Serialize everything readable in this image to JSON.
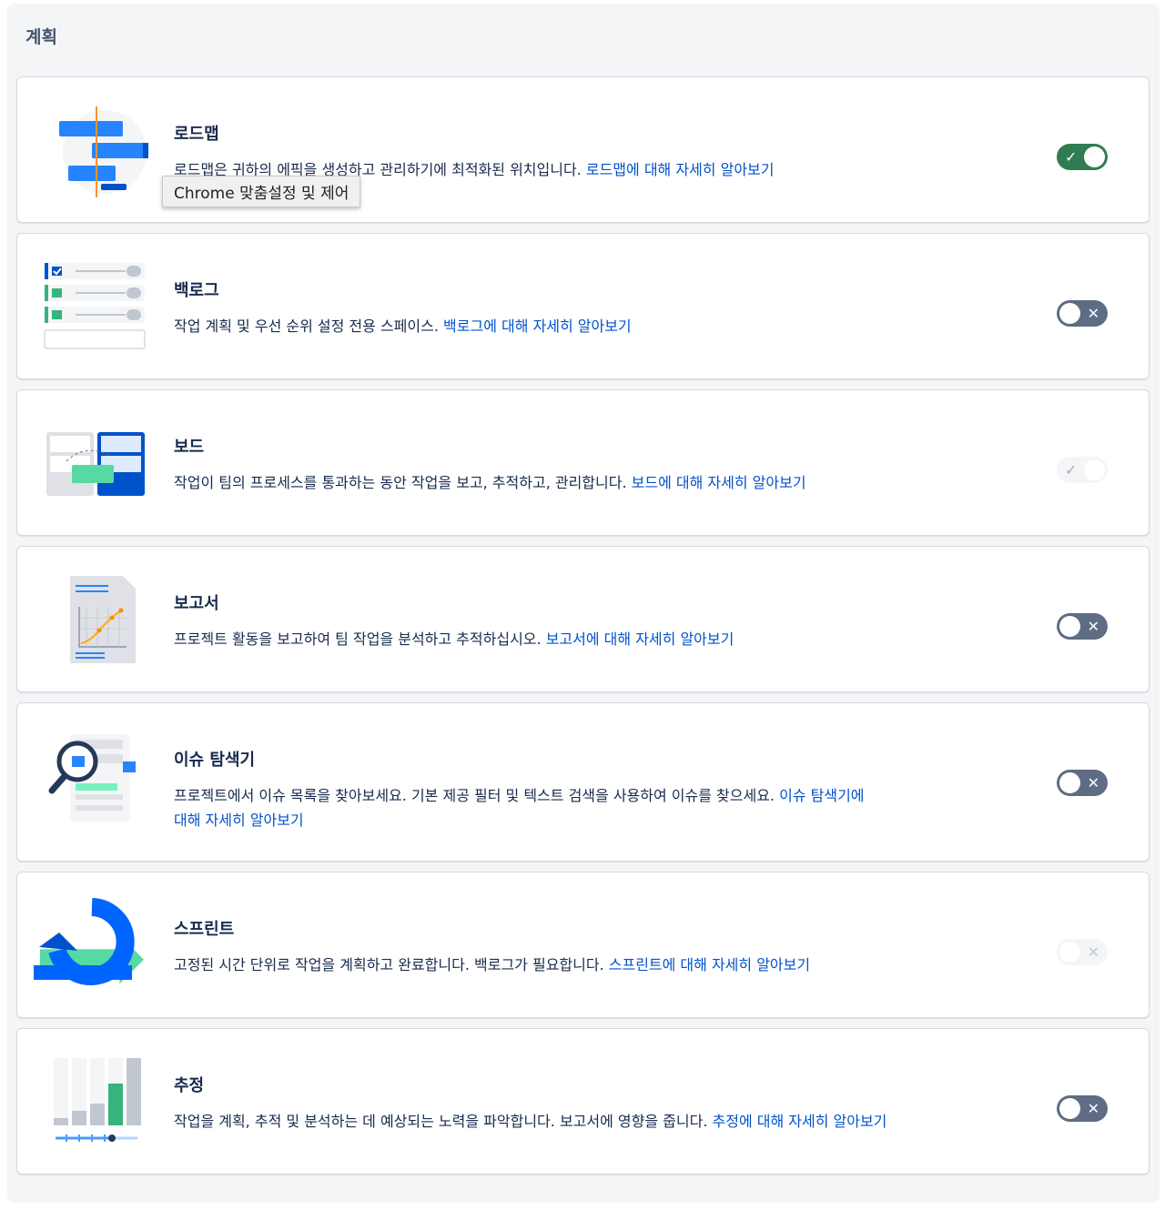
{
  "section": {
    "title": "계획"
  },
  "features": [
    {
      "title": "로드맵",
      "description": "로드맵은 귀하의 에픽을 생성하고 관리하기에 최적화된 위치입니다.",
      "link": "로드맵에 대해 자세히 알아보기",
      "toggle": {
        "state": "on",
        "enabled": true,
        "mark": "✓"
      },
      "icon": "roadmap-illustration"
    },
    {
      "title": "백로그",
      "description": "작업 계획 및 우선 순위 설정 전용 스페이스.",
      "link": "백로그에 대해 자세히 알아보기",
      "toggle": {
        "state": "off",
        "enabled": true,
        "mark": "✕"
      },
      "icon": "backlog-illustration"
    },
    {
      "title": "보드",
      "description": "작업이 팀의 프로세스를 통과하는 동안 작업을 보고, 추적하고, 관리합니다.",
      "link": "보드에 대해 자세히 알아보기",
      "toggle": {
        "state": "on",
        "enabled": false,
        "mark": "✓"
      },
      "icon": "board-illustration"
    },
    {
      "title": "보고서",
      "description": "프로젝트 활동을 보고하여 팀 작업을 분석하고 추적하십시오.",
      "link": "보고서에 대해 자세히 알아보기",
      "toggle": {
        "state": "off",
        "enabled": true,
        "mark": "✕"
      },
      "icon": "reports-illustration"
    },
    {
      "title": "이슈 탐색기",
      "description": "프로젝트에서 이슈 목록을 찾아보세요. 기본 제공 필터 및 텍스트 검색을 사용하여 이슈를 찾으세요.",
      "link": "이슈 탐색기에 대해 자세히 알아보기",
      "toggle": {
        "state": "off",
        "enabled": true,
        "mark": "✕"
      },
      "icon": "issue-navigator-illustration"
    },
    {
      "title": "스프린트",
      "description": "고정된 시간 단위로 작업을 계획하고 완료합니다. 백로그가 필요합니다.",
      "link": "스프린트에 대해 자세히 알아보기",
      "toggle": {
        "state": "off",
        "enabled": false,
        "mark": "✕"
      },
      "icon": "sprint-illustration"
    },
    {
      "title": "추정",
      "description": "작업을 계획, 추적 및 분석하는 데 예상되는 노력을 파악합니다. 보고서에 영향을 줍니다.",
      "link": "추정에 대해 자세히 알아보기",
      "toggle": {
        "state": "off",
        "enabled": true,
        "mark": "✕"
      },
      "icon": "estimation-illustration"
    }
  ],
  "tooltip": {
    "text": "Chrome 맞춤설정 및 제어"
  },
  "colors": {
    "link": "#0052cc",
    "toggle_on": "#2f7d51",
    "toggle_off": "#5e6c84",
    "text": "#172b4d"
  }
}
